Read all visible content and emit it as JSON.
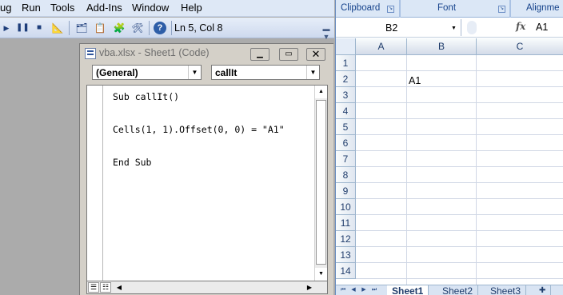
{
  "vbe": {
    "menu": [
      "ug",
      "Run",
      "Tools",
      "Add-Ins",
      "Window",
      "Help"
    ],
    "position_readout": "Ln 5, Col 8",
    "code_window": {
      "title": "vba.xlsx - Sheet1 (Code)",
      "object_combo": "(General)",
      "procedure_combo": "callIt",
      "code_lines": [
        "Sub callIt()",
        "",
        "Cells(1, 1).Offset(0, 0) = \"A1\"",
        "",
        "End Sub"
      ]
    }
  },
  "excel": {
    "ribbon_groups": [
      "Clipboard",
      "Font",
      "Alignme"
    ],
    "name_box": "B2",
    "fx_label": "fx",
    "formula": "A1",
    "columns": [
      "A",
      "B",
      "C"
    ],
    "rows": [
      "1",
      "2",
      "3",
      "4",
      "5",
      "6",
      "7",
      "8",
      "9",
      "10",
      "11",
      "12",
      "13",
      "14"
    ],
    "cell_b2": "A1",
    "sheet_tabs": [
      "Sheet1",
      "Sheet2",
      "Sheet3"
    ],
    "active_sheet": "Sheet1"
  }
}
